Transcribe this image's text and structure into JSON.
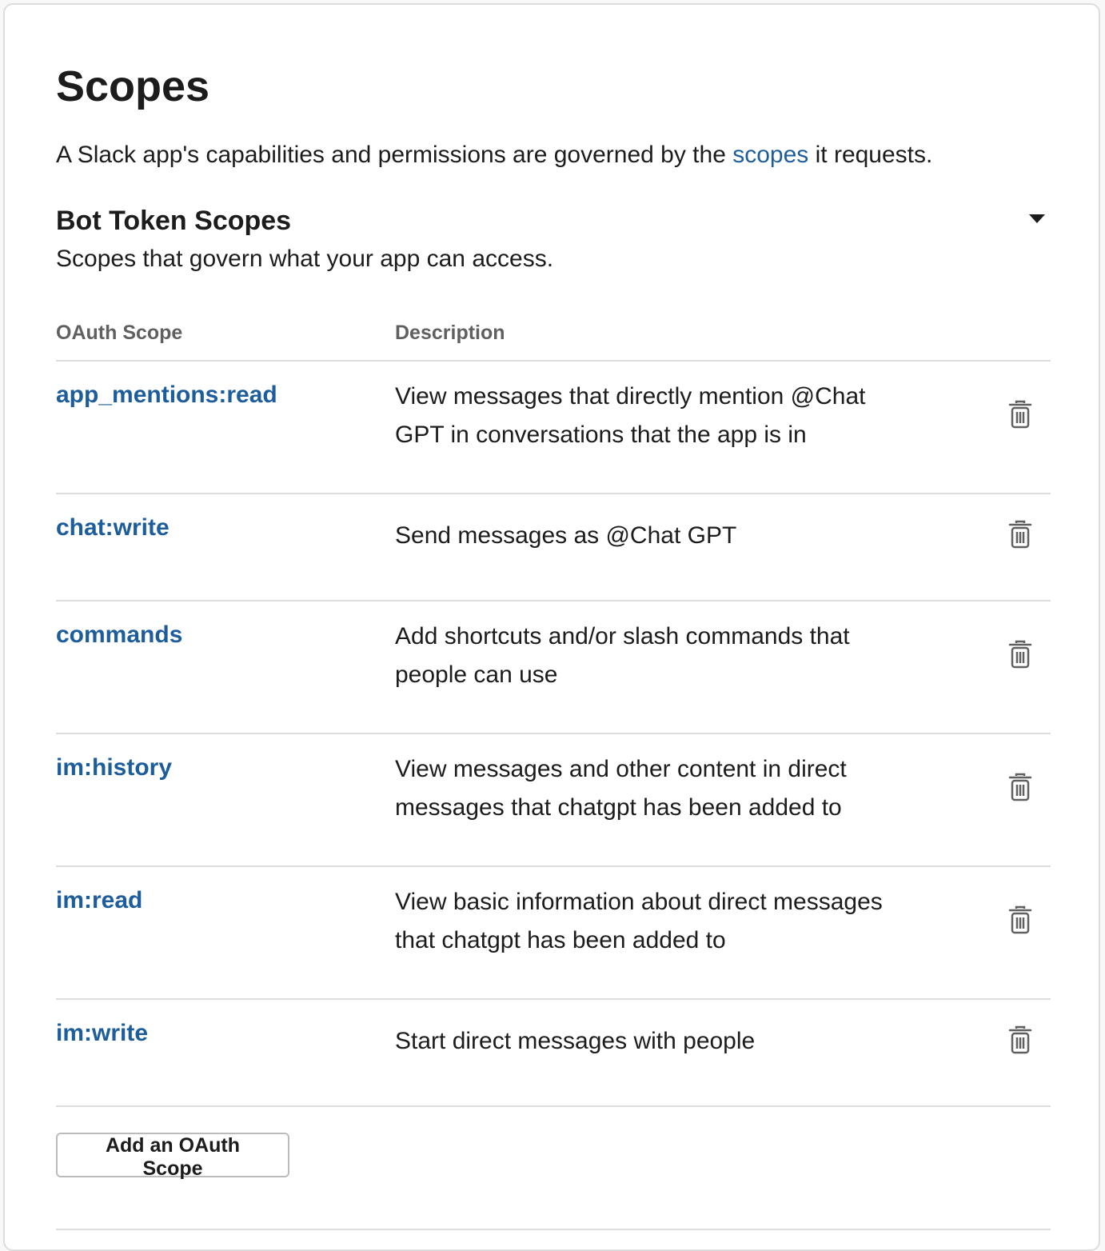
{
  "page": {
    "title": "Scopes",
    "intro_before": "A Slack app's capabilities and permissions are governed by the ",
    "intro_link": "scopes",
    "intro_after": " it requests."
  },
  "bot_token_scopes": {
    "title": "Bot Token Scopes",
    "subtitle": "Scopes that govern what your app can access.",
    "headers": {
      "scope": "OAuth Scope",
      "description": "Description"
    },
    "rows": [
      {
        "scope": "app_mentions:read",
        "description": "View messages that directly mention @Chat GPT in conversations that the app is in"
      },
      {
        "scope": "chat:write",
        "description": "Send messages as @Chat GPT"
      },
      {
        "scope": "commands",
        "description": "Add shortcuts and/or slash commands that people can use"
      },
      {
        "scope": "im:history",
        "description": "View messages and other content in direct messages that chatgpt has been added to"
      },
      {
        "scope": "im:read",
        "description": "View basic information about direct messages that chatgpt has been added to"
      },
      {
        "scope": "im:write",
        "description": "Start direct messages with people"
      }
    ],
    "add_button_label": "Add an OAuth Scope"
  },
  "icons": {
    "delete": "trash-icon",
    "toggle": "caret-down-icon"
  },
  "colors": {
    "link": "#1d5d9b",
    "text": "#1d1c1d",
    "muted": "#616061",
    "divider": "#dddddd"
  }
}
